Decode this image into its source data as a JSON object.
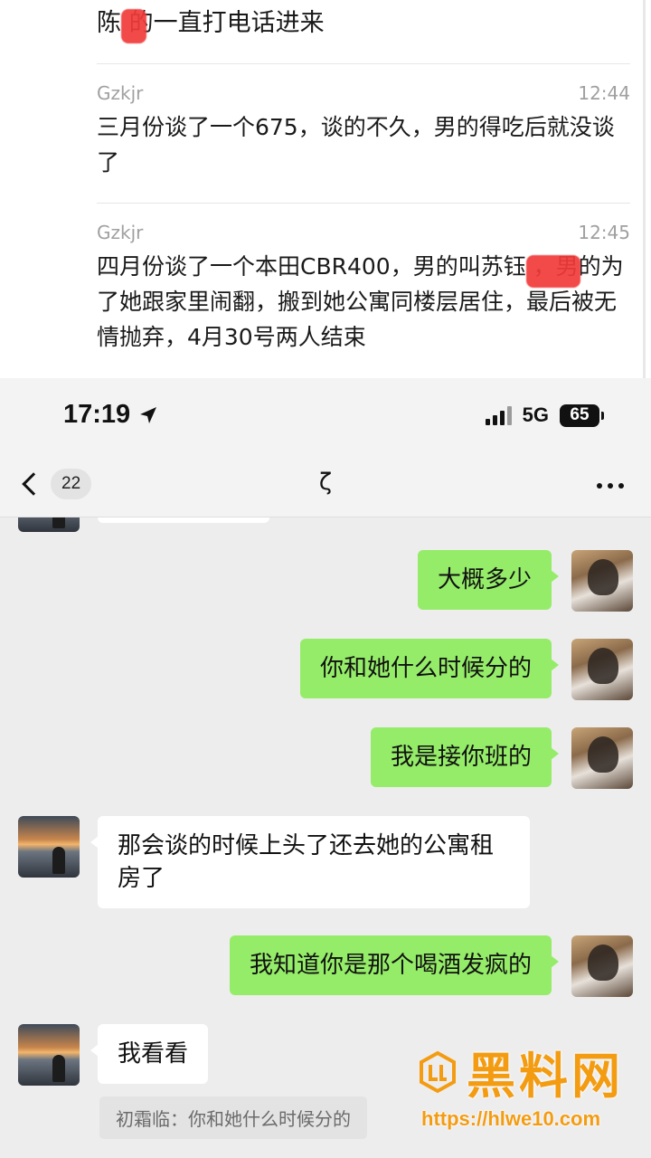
{
  "top_post": {
    "tail_text": "陈 的一直打电话进来",
    "comments": [
      {
        "user": "Gzkjr",
        "time": "12:44",
        "text": "三月份谈了一个675，谈的不久，男的得吃后就没谈了"
      },
      {
        "user": "Gzkjr",
        "time": "12:45",
        "text": "四月份谈了一个本田CBR400，男的叫苏钰 ，男的为了她跟家里闹翻，搬到她公寓同楼层居住，最后被无情抛弃，4月30号两人结束"
      }
    ]
  },
  "status_bar": {
    "time": "17:19",
    "network": "5G",
    "battery": "65"
  },
  "chat_header": {
    "back_count": "22",
    "title": "ζ"
  },
  "messages": [
    {
      "side": "right",
      "text": "大概多少"
    },
    {
      "side": "right",
      "text": "你和她什么时候分的"
    },
    {
      "side": "right",
      "text": "我是接你班的"
    },
    {
      "side": "left",
      "text": "那会谈的时候上头了还去她的公寓租房了"
    },
    {
      "side": "right",
      "text": "我知道你是那个喝酒发疯的"
    },
    {
      "side": "left",
      "text": "我看看"
    }
  ],
  "quote": "初霜临：你和她什么时候分的",
  "watermark": {
    "name": "黑料网",
    "url": "https://hlwe10.com"
  },
  "colors": {
    "bubble_green": "#95ec69",
    "bubble_white": "#ffffff",
    "chat_bg": "#ededed",
    "watermark": "#f39c12"
  }
}
